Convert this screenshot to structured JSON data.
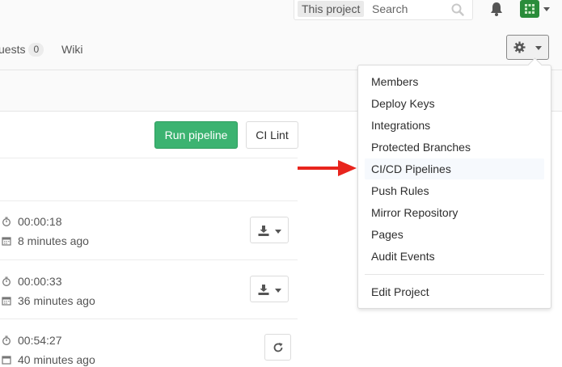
{
  "header": {
    "search_scope": "This project",
    "search_placeholder": "Search"
  },
  "nav": {
    "requests_label": "uests",
    "requests_count": "0",
    "wiki_label": "Wiki"
  },
  "actions": {
    "run_pipeline": "Run pipeline",
    "ci_lint": "CI Lint"
  },
  "pipelines": [
    {
      "duration": "00:00:18",
      "finished": "8 minutes ago"
    },
    {
      "duration": "00:00:33",
      "finished": "36 minutes ago"
    },
    {
      "duration": "00:54:27",
      "finished": "40 minutes ago"
    }
  ],
  "settings_menu": {
    "items": [
      "Members",
      "Deploy Keys",
      "Integrations",
      "Protected Branches",
      "CI/CD Pipelines",
      "Push Rules",
      "Mirror Repository",
      "Pages",
      "Audit Events"
    ],
    "highlighted": "CI/CD Pipelines",
    "footer_item": "Edit Project"
  },
  "colors": {
    "run_pipeline_bg": "#3cb371",
    "annotation_arrow": "#e8251d",
    "avatar_bg": "#2a8c3a"
  }
}
